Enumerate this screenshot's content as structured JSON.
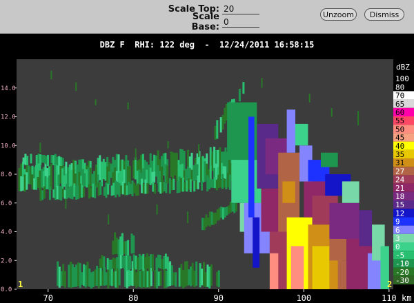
{
  "toolbar": {
    "scale_top_label": "Scale Top:",
    "scale_top_value": "20",
    "scale_base_label": "Scale Base:",
    "scale_base_value": "0",
    "unzoom_label": "Unzoom",
    "dismiss_label": "Dismiss"
  },
  "plot": {
    "title": "DBZ F  RHI: 122 deg  -  12/24/2011 16:58:15",
    "corner_left": "1",
    "corner_right": "2",
    "x_unit": "km"
  },
  "colors": {
    "plot_bg": "#3c3c3c",
    "axis_text": "#ffffff",
    "y_tick_text": "#f0b0c8",
    "corner_text": "#ffff40"
  },
  "legend": {
    "title": "dBZ",
    "entries": [
      {
        "label": "100",
        "color": "#000000"
      },
      {
        "label": "80",
        "color": "#000000"
      },
      {
        "label": "70",
        "color": "#ffffff"
      },
      {
        "label": "65",
        "color": "#d8d8d8"
      },
      {
        "label": "60",
        "color": "#ff00aa"
      },
      {
        "label": "55",
        "color": "#ff4866"
      },
      {
        "label": "50",
        "color": "#ff8d80"
      },
      {
        "label": "45",
        "color": "#f6a282"
      },
      {
        "label": "40",
        "color": "#ffff00"
      },
      {
        "label": "35",
        "color": "#e8c800"
      },
      {
        "label": "31",
        "color": "#d09018"
      },
      {
        "label": "27",
        "color": "#b26446"
      },
      {
        "label": "24",
        "color": "#a03c5a"
      },
      {
        "label": "21",
        "color": "#902868"
      },
      {
        "label": "18",
        "color": "#7a2a80"
      },
      {
        "label": "15",
        "color": "#5a2a8a"
      },
      {
        "label": "12",
        "color": "#1414c8"
      },
      {
        "label": "9",
        "color": "#1e32ff"
      },
      {
        "label": "6",
        "color": "#8484ff"
      },
      {
        "label": "3",
        "color": "#78d8a8"
      },
      {
        "label": "0",
        "color": "#3cd28c"
      },
      {
        "label": "-5",
        "color": "#28c070"
      },
      {
        "label": "-10",
        "color": "#1e9650"
      },
      {
        "label": "-20",
        "color": "#287828"
      },
      {
        "label": "-30",
        "color": "#2e6424"
      }
    ]
  },
  "chart_data": {
    "type": "heatmap",
    "x_ticks": [
      "70",
      "80",
      "90",
      "100",
      "110"
    ],
    "y_ticks": [
      "0.0",
      "2.0",
      "4.0",
      "6.0",
      "8.0",
      "10.0",
      "12.0",
      "14.0"
    ],
    "xlim": [
      66.3,
      110.5
    ],
    "ylim": [
      0,
      16
    ],
    "bands": [
      {
        "x0": 66.5,
        "x1": 92.5,
        "y0a": 7.3,
        "y0b": 8.4,
        "th": 1.6,
        "p": [
          0.1,
          0.25,
          0.35,
          0.3
        ]
      },
      {
        "x0": 66.5,
        "x1": 92.5,
        "y0a": 7.0,
        "y0b": 7.8,
        "th": 1.2,
        "p": [
          0.1,
          0.25,
          0.35,
          0.3
        ]
      },
      {
        "x0": 69,
        "x1": 92.5,
        "y0a": 6.3,
        "y0b": 7.2,
        "th": 0.9,
        "p": [
          0.1,
          0.2,
          0.4,
          0.3
        ]
      },
      {
        "x0": 67,
        "x1": 72,
        "y0a": 8.8,
        "y0b": 8.8,
        "th": 0.6,
        "p": [
          0.3,
          0.3,
          0.3,
          0.1
        ]
      },
      {
        "x0": 71,
        "x1": 90,
        "y0a": 0.3,
        "y0b": 0.3,
        "th": 1.6,
        "p": [
          0.05,
          0.15,
          0.35,
          0.45
        ]
      },
      {
        "x0": 76,
        "x1": 84,
        "y0a": 1.5,
        "y0b": 1.5,
        "th": 1.0,
        "p": [
          0.05,
          0.2,
          0.4,
          0.35
        ]
      },
      {
        "x0": 77.5,
        "x1": 80,
        "y0a": 2.5,
        "y0b": 2.5,
        "th": 1.4,
        "p": [
          0,
          0.1,
          0.45,
          0.45
        ]
      },
      {
        "x0": 88,
        "x1": 92,
        "y0a": 4.2,
        "y0b": 5.6,
        "th": 0.9,
        "p": [
          0,
          0.1,
          0.4,
          0.5
        ]
      },
      {
        "x0": 89.5,
        "x1": 93,
        "y0a": 10.5,
        "y0b": 13.8,
        "th": 1.1,
        "p": [
          0.1,
          0.3,
          0.35,
          0.25
        ]
      }
    ],
    "cells": [
      {
        "x0": 91.0,
        "x1": 94.5,
        "y0": 9.0,
        "y1": 13.0,
        "c": "-10"
      },
      {
        "x0": 91.5,
        "x1": 95.0,
        "y0": 6.0,
        "y1": 9.0,
        "c": "0"
      },
      {
        "x0": 92.5,
        "x1": 95.0,
        "y0": 4.0,
        "y1": 6.0,
        "c": "3"
      },
      {
        "x0": 93.0,
        "x1": 96.0,
        "y0": 2.5,
        "y1": 6.0,
        "c": "6"
      },
      {
        "x0": 93.5,
        "x1": 94.2,
        "y0": 5.0,
        "y1": 12.0,
        "c": "9"
      },
      {
        "x0": 94.0,
        "x1": 94.8,
        "y0": 1.5,
        "y1": 5.0,
        "c": "12"
      },
      {
        "x0": 94.5,
        "x1": 97.0,
        "y0": 7.0,
        "y1": 11.5,
        "c": "15"
      },
      {
        "x0": 95.0,
        "x1": 97.5,
        "y0": 4.0,
        "y1": 7.0,
        "c": "21"
      },
      {
        "x0": 95.5,
        "x1": 98.0,
        "y0": 8.0,
        "y1": 10.5,
        "c": "18"
      },
      {
        "x0": 96.0,
        "x1": 98.0,
        "y0": 0.0,
        "y1": 4.0,
        "c": "24"
      },
      {
        "x0": 96.0,
        "x1": 97.0,
        "y0": 0.0,
        "y1": 2.5,
        "c": "50"
      },
      {
        "x0": 97.0,
        "x1": 99.5,
        "y0": 4.0,
        "y1": 9.5,
        "c": "27"
      },
      {
        "x0": 97.5,
        "x1": 99.0,
        "y0": 6.0,
        "y1": 7.5,
        "c": "31"
      },
      {
        "x0": 98.0,
        "x1": 101.0,
        "y0": 0.0,
        "y1": 5.0,
        "c": "40"
      },
      {
        "x0": 98.5,
        "x1": 100.0,
        "y0": 0.0,
        "y1": 3.0,
        "c": "50"
      },
      {
        "x0": 100.0,
        "x1": 101.5,
        "y0": 0.0,
        "y1": 0.8,
        "c": "40"
      },
      {
        "x0": 100.5,
        "x1": 104.5,
        "y0": 0.0,
        "y1": 4.5,
        "c": "31"
      },
      {
        "x0": 101.0,
        "x1": 103.0,
        "y0": 0.0,
        "y1": 3.0,
        "c": "35"
      },
      {
        "x0": 103.0,
        "x1": 105.0,
        "y0": 2.0,
        "y1": 4.5,
        "c": "27"
      },
      {
        "x0": 100.0,
        "x1": 103.0,
        "y0": 5.0,
        "y1": 8.0,
        "c": "21"
      },
      {
        "x0": 101.0,
        "x1": 104.0,
        "y0": 4.5,
        "y1": 6.5,
        "c": "24"
      },
      {
        "x0": 103.0,
        "x1": 106.5,
        "y0": 3.5,
        "y1": 6.0,
        "c": "18"
      },
      {
        "x0": 104.0,
        "x1": 107.0,
        "y0": 0.0,
        "y1": 2.0,
        "c": "27"
      },
      {
        "x0": 105.0,
        "x1": 108.0,
        "y0": 0.0,
        "y1": 3.5,
        "c": "21"
      },
      {
        "x0": 106.5,
        "x1": 108.0,
        "y0": 3.0,
        "y1": 5.5,
        "c": "15"
      },
      {
        "x0": 107.5,
        "x1": 109.5,
        "y0": 0.0,
        "y1": 2.5,
        "c": "6"
      },
      {
        "x0": 108.0,
        "x1": 109.5,
        "y0": 2.0,
        "y1": 4.5,
        "c": "3"
      },
      {
        "x0": 99.5,
        "x1": 101.0,
        "y0": 7.5,
        "y1": 10.0,
        "c": "6"
      },
      {
        "x0": 100.5,
        "x1": 103.0,
        "y0": 7.5,
        "y1": 9.0,
        "c": "9"
      },
      {
        "x0": 102.5,
        "x1": 105.5,
        "y0": 6.5,
        "y1": 8.0,
        "c": "12"
      },
      {
        "x0": 104.5,
        "x1": 106.5,
        "y0": 6.0,
        "y1": 7.5,
        "c": "3"
      },
      {
        "x0": 98.0,
        "x1": 99.0,
        "y0": 9.5,
        "y1": 12.5,
        "c": "6"
      },
      {
        "x0": 99.0,
        "x1": 100.5,
        "y0": 10.0,
        "y1": 11.5,
        "c": "0"
      },
      {
        "x0": 102.0,
        "x1": 104.0,
        "y0": 8.5,
        "y1": 9.5,
        "c": "-10"
      },
      {
        "x0": 109.0,
        "x1": 110.0,
        "y0": 0.0,
        "y1": 3.0,
        "c": "0"
      }
    ],
    "sparse": [
      {
        "x": 70.3,
        "y0": 14.6,
        "y1": 15.2
      },
      {
        "x": 73.2,
        "y0": 13.8,
        "y1": 14.4
      },
      {
        "x": 75.5,
        "y0": 12.8,
        "y1": 13.2
      },
      {
        "x": 69.0,
        "y0": 9.5,
        "y1": 10.2
      },
      {
        "x": 80.2,
        "y0": 9.0,
        "y1": 9.8
      },
      {
        "x": 84.0,
        "y0": 9.8,
        "y1": 10.3
      },
      {
        "x": 87.6,
        "y0": 9.2,
        "y1": 10.1
      },
      {
        "x": 79.3,
        "y0": 12.5,
        "y1": 13.0
      },
      {
        "x": 72.0,
        "y0": 5.6,
        "y1": 6.3
      },
      {
        "x": 82.7,
        "y0": 5.2,
        "y1": 5.9
      },
      {
        "x": 86.3,
        "y0": 4.6,
        "y1": 5.4
      },
      {
        "x": 77.0,
        "y0": 4.5,
        "y1": 5.2
      },
      {
        "x": 106.3,
        "y0": 11.4,
        "y1": 12.4
      },
      {
        "x": 100.6,
        "y0": 13.0,
        "y1": 13.6
      },
      {
        "x": 89.2,
        "y0": 8.8,
        "y1": 9.6
      },
      {
        "x": 95.0,
        "y0": 14.0,
        "y1": 14.7
      },
      {
        "x": 103.2,
        "y0": 12.0,
        "y1": 12.6
      }
    ]
  }
}
